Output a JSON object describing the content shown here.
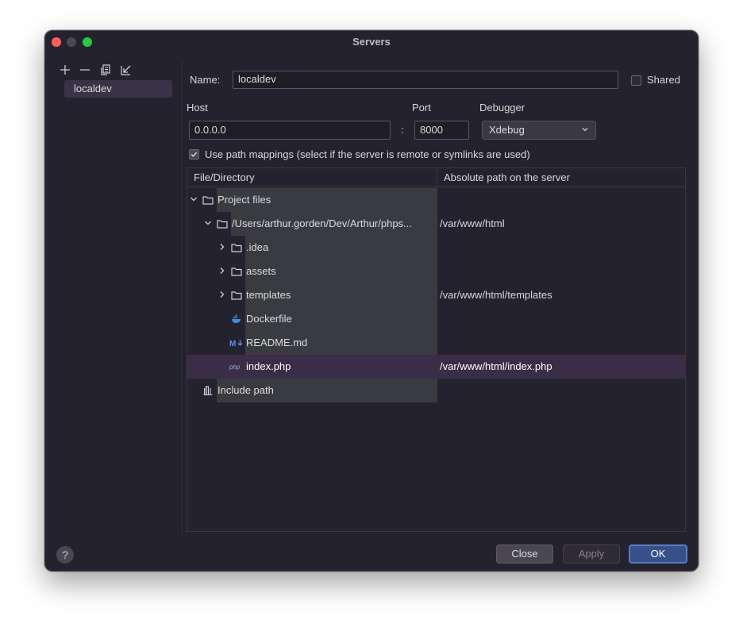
{
  "window": {
    "title": "Servers"
  },
  "sidebar": {
    "toolbar": [
      {
        "icon": "plus-icon"
      },
      {
        "icon": "minus-icon"
      },
      {
        "icon": "copy-icon"
      },
      {
        "icon": "import-icon"
      }
    ],
    "servers": [
      {
        "label": "localdev"
      }
    ]
  },
  "form": {
    "name_label": "Name:",
    "name_value": "localdev",
    "shared_label": "Shared",
    "shared_checked": false,
    "host_label": "Host",
    "host_value": "0.0.0.0",
    "colon": ":",
    "port_label": "Port",
    "port_value": "8000",
    "debugger_label": "Debugger",
    "debugger_value": "Xdebug",
    "path_mappings_label": "Use path mappings (select if the server is remote or symlinks are used)",
    "path_mappings_checked": true
  },
  "table": {
    "headers": [
      "File/Directory",
      "Absolute path on the server"
    ],
    "rows": [
      {
        "name": "Project files",
        "path": "",
        "icon": "folder-icon",
        "expanded": true
      },
      {
        "name": "/Users/arthur.gorden/Dev/Arthur/phps...",
        "path": "/var/www/html",
        "icon": "folder-icon",
        "expanded": true
      },
      {
        "name": ".idea",
        "path": "",
        "icon": "folder-icon",
        "expanded": false
      },
      {
        "name": "assets",
        "path": "",
        "icon": "folder-icon",
        "expanded": false
      },
      {
        "name": "templates",
        "path": "/var/www/html/templates",
        "icon": "folder-icon",
        "expanded": false
      },
      {
        "name": "Dockerfile",
        "path": "",
        "icon": "docker-icon"
      },
      {
        "name": "README.md",
        "path": "",
        "icon": "markdown-icon"
      },
      {
        "name": "index.php",
        "path": "/var/www/html/index.php",
        "icon": "php-icon",
        "selected": true
      },
      {
        "name": "Include path",
        "path": "",
        "icon": "library-icon"
      }
    ]
  },
  "footer": {
    "help": "?",
    "close_label": "Close",
    "apply_label": "Apply",
    "ok_label": "OK"
  },
  "colors": {
    "window_bg": "#25222f",
    "selection": "#3a2d48",
    "ok_button": "#37508a"
  }
}
